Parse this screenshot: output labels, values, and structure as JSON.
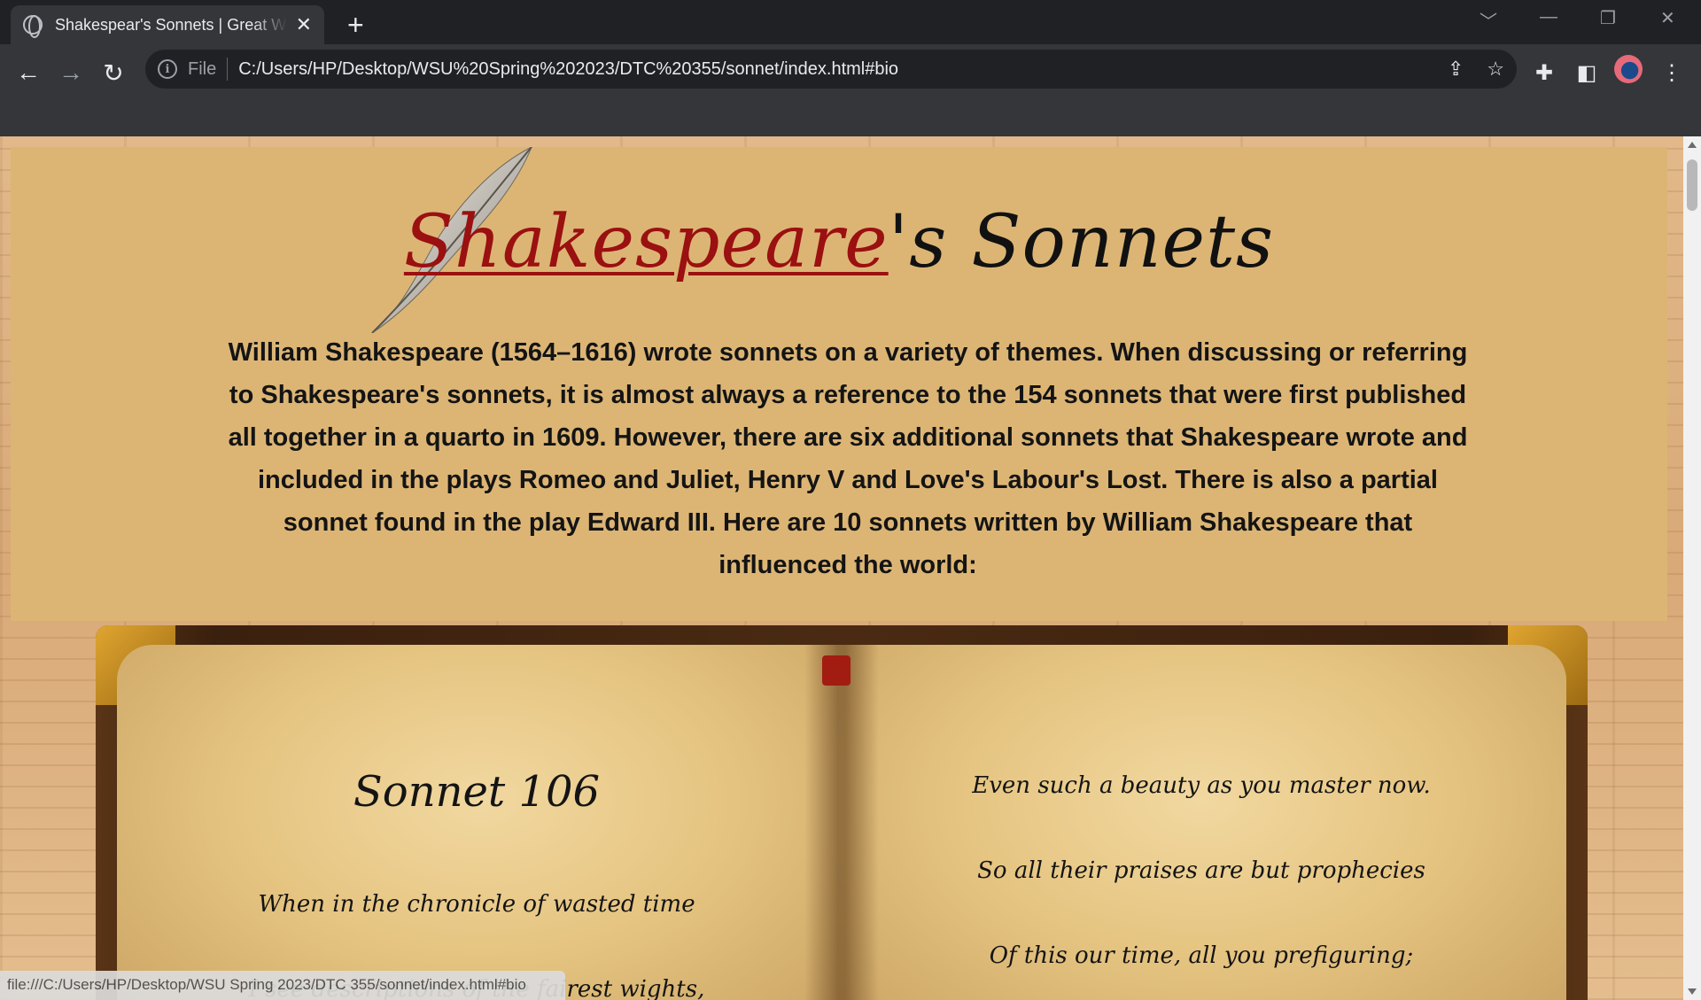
{
  "browser": {
    "tab_title": "Shakespear's Sonnets | Great Writers",
    "tab_close": "✕",
    "new_tab": "+",
    "file_label": "File",
    "url": "C:/Users/HP/Desktop/WSU%20Spring%202023/DTC%20355/sonnet/index.html#bio",
    "status_url": "file:///C:/Users/HP/Desktop/WSU Spring 2023/DTC 355/sonnet/index.html#bio"
  },
  "header": {
    "title_link": "Shakespeare",
    "title_rest": "'s Sonnets",
    "intro": "William Shakespeare (1564–1616) wrote sonnets on a variety of themes. When discussing or referring to Shakespeare's sonnets, it is almost always a reference to the 154 sonnets that were first published all together in a quarto in 1609. However, there are six additional sonnets that Shakespeare wrote and included in the plays Romeo and Juliet, Henry V and Love's Labour's Lost. There is also a partial sonnet found in the play Edward III. Here are 10 sonnets written by William Shakespeare that influenced the world:"
  },
  "sonnet": {
    "title": "Sonnet 106",
    "left_lines": [
      "When in the chronicle of wasted time",
      "I see descriptions of the fairest wights,"
    ],
    "right_lines": [
      "Even such a beauty as you master now.",
      "So all their praises are but prophecies",
      "Of this our time, all you prefiguring;"
    ]
  },
  "colors": {
    "title_link": "#9b1010",
    "hero_bg": "#dcb575",
    "chrome_bg": "#35363a"
  },
  "icons": [
    "globe-icon",
    "close-icon",
    "plus-icon",
    "back-icon",
    "forward-icon",
    "reload-icon",
    "info-icon",
    "share-icon",
    "star-icon",
    "extensions-icon",
    "side-panel-icon",
    "profile-avatar",
    "menu-icon",
    "quill-icon"
  ]
}
